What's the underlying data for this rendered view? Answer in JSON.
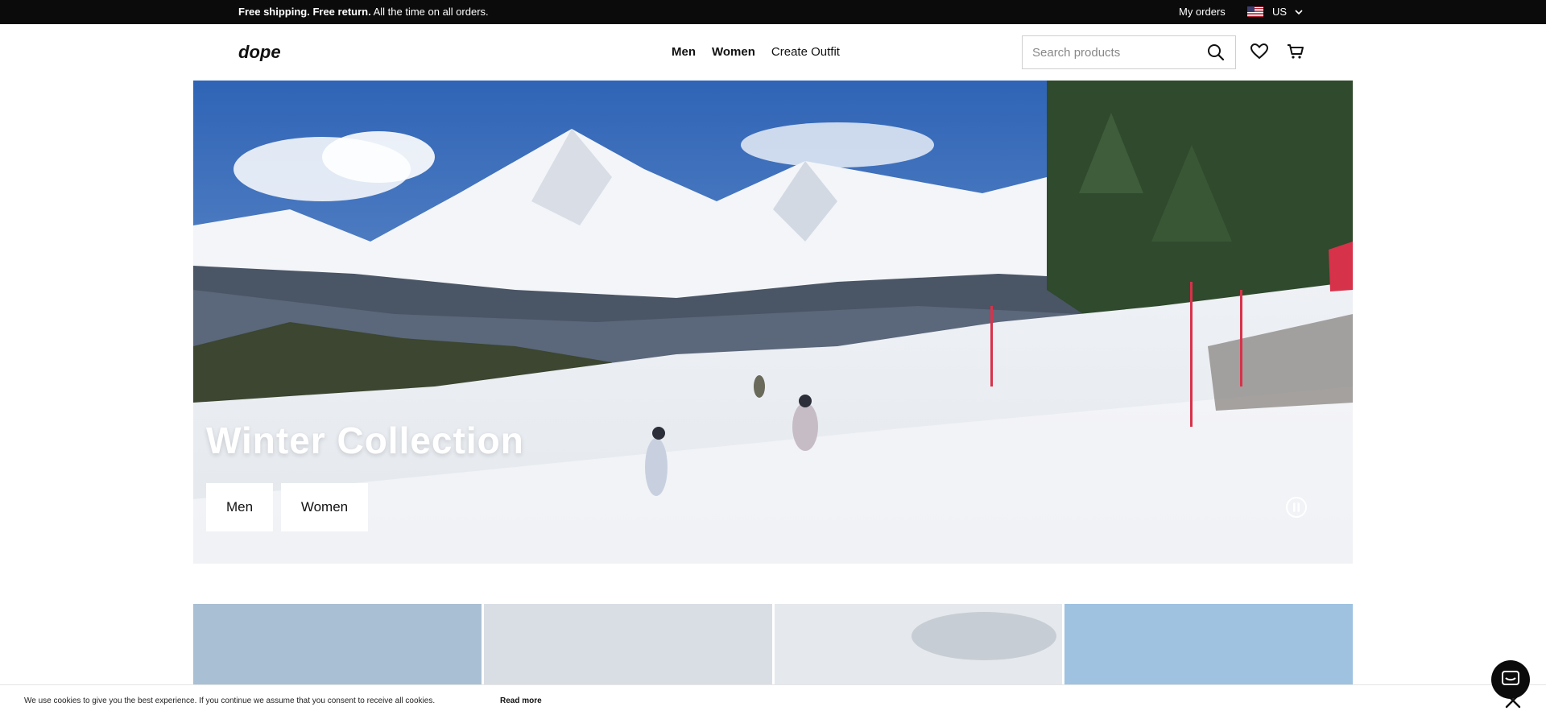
{
  "topbar": {
    "promo_bold": "Free shipping. Free return.",
    "promo_rest": " All the time on all orders.",
    "orders_label": "My orders",
    "country": "US"
  },
  "header": {
    "logo_text": "dope",
    "nav": [
      "Men",
      "Women",
      "Create Outfit"
    ],
    "search_placeholder": "Search products"
  },
  "hero": {
    "title": "Winter Collection",
    "buttons": [
      "Men",
      "Women"
    ]
  },
  "cookie": {
    "text": "We use cookies to give you the best experience. If you continue we assume that you consent to receive all cookies.",
    "link": "Read more"
  },
  "colors": {
    "topbar_bg": "#0b0b0b",
    "sky": "#3f6fb6",
    "snow": "#f1f3f6",
    "accent": "#111111"
  }
}
